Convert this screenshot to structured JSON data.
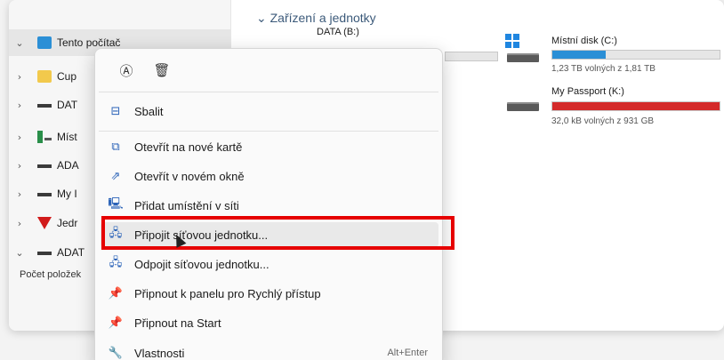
{
  "nav": {
    "items": [
      {
        "label": "Tento počítač",
        "chev": "⌄"
      },
      {
        "label": "Cup",
        "chev": "›"
      },
      {
        "label": "DAT",
        "chev": "›"
      },
      {
        "label": "Míst",
        "chev": "›"
      },
      {
        "label": "ADA",
        "chev": "›"
      },
      {
        "label": "My I",
        "chev": "›"
      },
      {
        "label": "Jedr",
        "chev": "›"
      },
      {
        "label": "ADAT",
        "chev": "⌄"
      }
    ],
    "status": "Počet položek"
  },
  "content": {
    "section_title": "⌄ Zařízení a jednotky",
    "drives": [
      {
        "name": "DATA (B:)"
      },
      {
        "name": "Místní disk (C:)",
        "free": "1,23 TB volných z 1,81 TB",
        "fill_color": "#2b8fd6",
        "used_fraction": 0.32
      },
      {
        "name": "My Passport (K:)",
        "free": "32,0 kB volných z 931 GB",
        "fill_color": "#d42a2a",
        "used_fraction": 1.0
      }
    ]
  },
  "menu": {
    "top_actions": [
      {
        "icon": "rename-icon",
        "glyph": "Ⓐ"
      },
      {
        "icon": "delete-icon",
        "glyph": "🗑"
      }
    ],
    "items": [
      {
        "label": "Sbalit",
        "icon": "collapse-icon",
        "glyph": "⊟"
      },
      {
        "label": "Otevřít na nové kartě",
        "icon": "new-tab-icon",
        "glyph": "⧉"
      },
      {
        "label": "Otevřít v novém okně",
        "icon": "new-window-icon",
        "glyph": "⇗"
      },
      {
        "label": "Přidat umístění v síti",
        "icon": "network-location-icon",
        "glyph": "🖳"
      },
      {
        "label": "Připojit síťovou jednotku...",
        "icon": "map-drive-icon",
        "glyph": "🖧"
      },
      {
        "label": "Odpojit síťovou jednotku...",
        "icon": "disconnect-drive-icon",
        "glyph": "🖧"
      },
      {
        "label": "Připnout k panelu pro Rychlý přístup",
        "icon": "pin-icon",
        "glyph": "📌"
      },
      {
        "label": "Připnout na Start",
        "icon": "pin-start-icon",
        "glyph": "📌"
      },
      {
        "label": "Vlastnosti",
        "icon": "properties-icon",
        "glyph": "🔧",
        "shortcut": "Alt+Enter"
      }
    ]
  },
  "colors": {
    "highlight": "#e60000",
    "accent": "#2b63b8"
  }
}
